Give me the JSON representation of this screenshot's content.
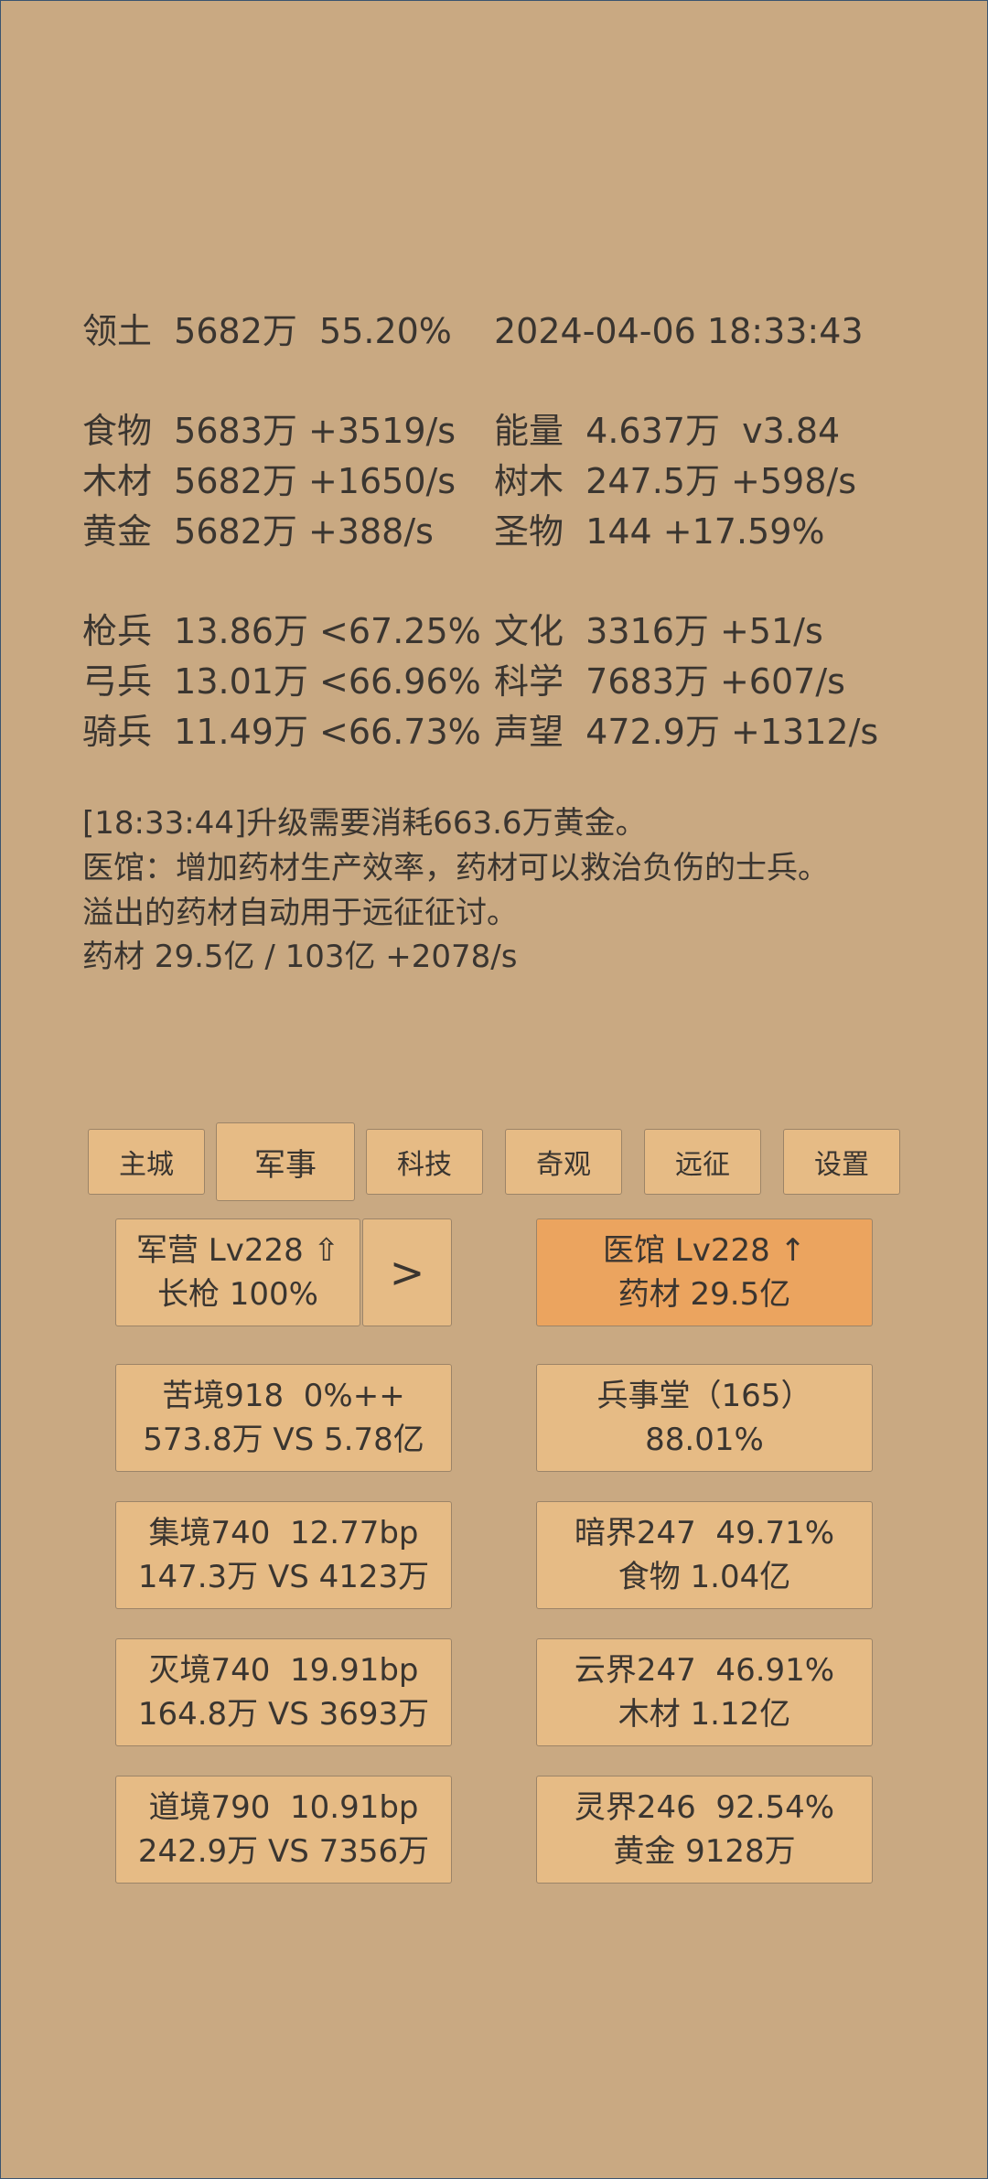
{
  "header": {
    "territory": "领土  5682万  55.20%",
    "datetime": "2024-04-06 18:33:43"
  },
  "resources": {
    "food": "食物  5683万 +3519/s",
    "energy": "能量  4.637万  v3.84",
    "wood": "木材  5682万 +1650/s",
    "trees": "树木  247.5万 +598/s",
    "gold": "黄金  5682万 +388/s",
    "relics": "圣物  144 +17.59%"
  },
  "troops": {
    "spearmen": "枪兵  13.86万 <67.25%",
    "culture": "文化  3316万 +51/s",
    "archers": "弓兵  13.01万 <66.96%",
    "science": "科学  7683万 +607/s",
    "cavalry": "骑兵  11.49万 <66.73%",
    "prestige": "声望  472.9万 +1312/s"
  },
  "log": {
    "line1": "[18:33:44]升级需要消耗663.6万黄金。",
    "line2": "医馆：增加药材生产效率，药材可以救治负伤的士兵。",
    "line3": "溢出的药材自动用于远征征讨。",
    "line4": "药材 29.5亿 / 103亿 +2078/s"
  },
  "tabs": {
    "main_city": "主城",
    "military": "军事",
    "tech": "科技",
    "wonders": "奇观",
    "expedition": "远征",
    "settings": "设置"
  },
  "buildings": {
    "barracks_line1": "军营 Lv228 ⇧",
    "barracks_line2": "长枪 100%",
    "next_arrow": ">",
    "clinic_line1": "医馆 Lv228 ↑",
    "clinic_line2": "药材 29.5亿"
  },
  "realms": {
    "r1_line1": "苦境918  0%++",
    "r1_line2": "573.8万 VS 5.78亿",
    "r2_line1": "兵事堂（165）",
    "r2_line2": "88.01%",
    "r3_line1": "集境740  12.77bp",
    "r3_line2": "147.3万 VS 4123万",
    "r4_line1": "暗界247  49.71%",
    "r4_line2": "食物 1.04亿",
    "r5_line1": "灭境740  19.91bp",
    "r5_line2": "164.8万 VS 3693万",
    "r6_line1": "云界247  46.91%",
    "r6_line2": "木材 1.12亿",
    "r7_line1": "道境790  10.91bp",
    "r7_line2": "242.9万 VS 7356万",
    "r8_line1": "灵界246  92.54%",
    "r8_line2": "黄金 9128万"
  },
  "colors": {
    "background": "#c9a982",
    "button": "#e6bb85",
    "button_highlight": "#eba45f",
    "text": "#3a3530"
  }
}
